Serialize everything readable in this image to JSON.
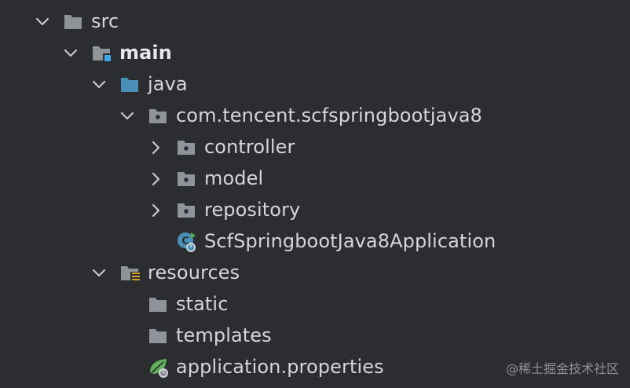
{
  "tree": {
    "src": "src",
    "main": "main",
    "java": "java",
    "package": "com.tencent.scfspringbootjava8",
    "controller": "controller",
    "model": "model",
    "repository": "repository",
    "app_class": "ScfSpringbootJava8Application",
    "resources": "resources",
    "static": "static",
    "templates": "templates",
    "app_props": "application.properties"
  },
  "watermark": "@稀土掘金技术社区",
  "colors": {
    "background": "#2b2d30",
    "text": "#d4d6da",
    "folder_gray": "#8f949a",
    "source_folder_blue": "#4a8fb8",
    "module_marker": "#3aa7e6",
    "resources_stripes": "#d6a22c",
    "spring_green": "#5fb05a"
  }
}
